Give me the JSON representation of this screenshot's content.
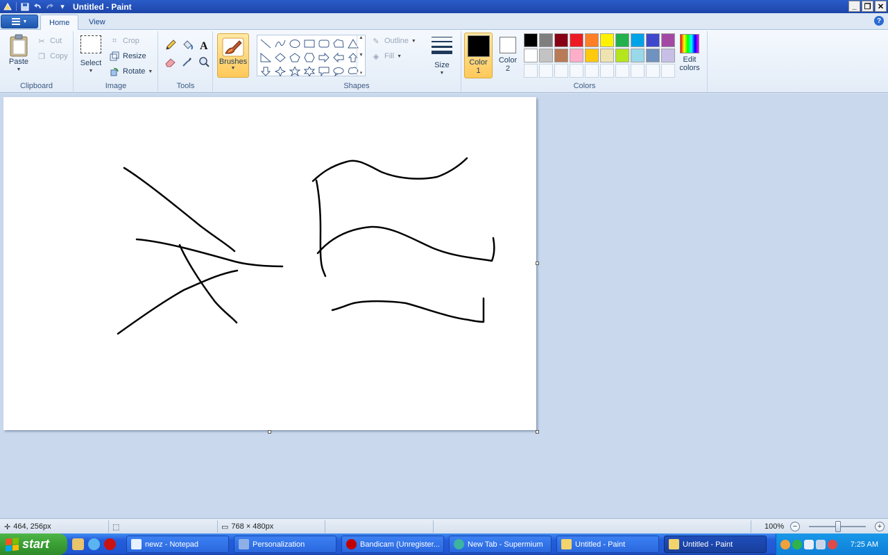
{
  "window": {
    "title": "Untitled - Paint"
  },
  "tabs": [
    {
      "label": "Home"
    },
    {
      "label": "View"
    }
  ],
  "clipboard": {
    "group_label": "Clipboard",
    "paste": "Paste",
    "cut": "Cut",
    "copy": "Copy"
  },
  "image": {
    "group_label": "Image",
    "select": "Select",
    "crop": "Crop",
    "resize": "Resize",
    "rotate": "Rotate"
  },
  "tools": {
    "group_label": "Tools"
  },
  "brushes": {
    "label": "Brushes"
  },
  "shapes": {
    "group_label": "Shapes",
    "outline": "Outline",
    "fill": "Fill"
  },
  "size": {
    "label": "Size"
  },
  "colors": {
    "group_label": "Colors",
    "color1_line1": "Color",
    "color1_line2": "1",
    "color2_line1": "Color",
    "color2_line2": "2",
    "color1_value": "#000000",
    "color2_value": "#ffffff",
    "edit_line1": "Edit",
    "edit_line2": "colors",
    "palette_row1": [
      "#000000",
      "#7f7f7f",
      "#880015",
      "#ed1c24",
      "#ff7f27",
      "#fff200",
      "#22b14c",
      "#00a2e8",
      "#3f48cc",
      "#a349a4"
    ],
    "palette_row2": [
      "#ffffff",
      "#c3c3c3",
      "#b97a57",
      "#ffaec9",
      "#ffc90e",
      "#efe4b0",
      "#b5e61d",
      "#99d9ea",
      "#7092be",
      "#c8bfe7"
    ]
  },
  "status": {
    "cursor_pos": "464, 256px",
    "canvas_size": "768 × 480px",
    "zoom": "100%"
  },
  "taskbar": {
    "start": "start",
    "items": [
      {
        "label": "newz - Notepad",
        "icon_color": "#e8f1ff"
      },
      {
        "label": "Personalization",
        "icon_color": "#8fb0e6"
      },
      {
        "label": "Bandicam (Unregister...",
        "icon_color": "#c00000"
      },
      {
        "label": "New Tab - Supermium",
        "icon_color": "#3cb4a0"
      },
      {
        "label": "Untitled - Paint",
        "icon_color": "#f3d36b"
      },
      {
        "label": "Untitled - Paint",
        "icon_color": "#f3d36b"
      }
    ],
    "clock": "7:25 AM"
  }
}
